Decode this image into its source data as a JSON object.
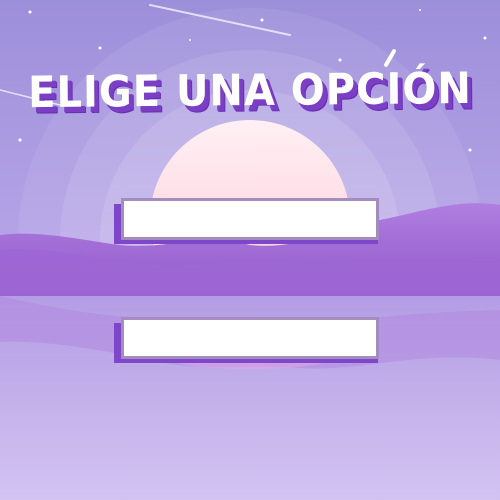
{
  "title": "ELIGE UNA OPCIÓN",
  "options": [
    {
      "label": ""
    },
    {
      "label": ""
    }
  ],
  "colors": {
    "sky_top": "#9b8bd9",
    "sky_mid": "#b7a4e6",
    "sun": "#ffd4e6",
    "mountains": "#a773d6",
    "water": "#c9b6ee",
    "title_shadow": "#7a3fc4",
    "button_fill": "#ffffff",
    "button_border": "#a48cbf",
    "button_shadow": "#7e47c9"
  }
}
